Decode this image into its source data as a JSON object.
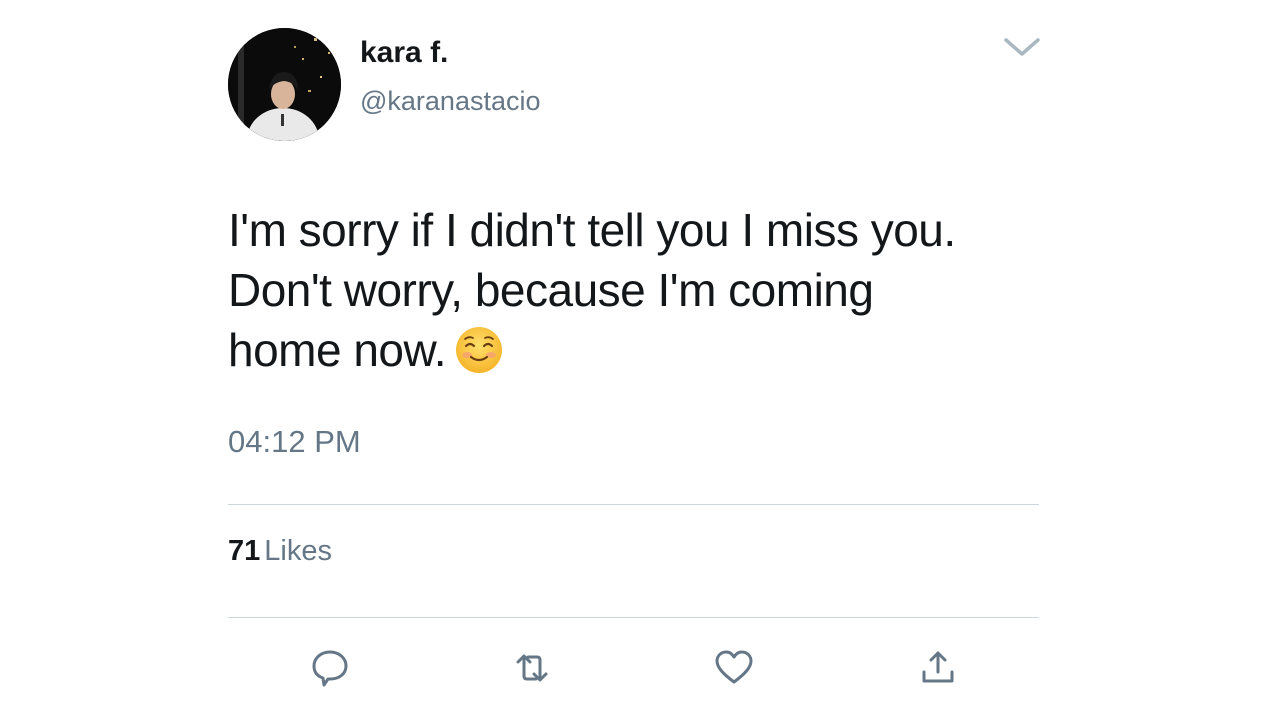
{
  "user": {
    "display_name": "kara f.",
    "handle": "@karanastacio",
    "avatar_icon": "profile-photo"
  },
  "tweet": {
    "lines": [
      "I'm sorry if I didn't tell you I miss you.",
      "Don't worry, because I'm coming",
      "home now."
    ],
    "emoji_icon": "smiling-face-with-blush-emoji",
    "timestamp": "04:12 PM"
  },
  "stats": {
    "likes_count": "71",
    "likes_label": "Likes"
  },
  "actions": {
    "reply_icon": "reply-icon",
    "retweet_icon": "retweet-icon",
    "like_icon": "heart-icon",
    "share_icon": "share-icon"
  },
  "colors": {
    "text_primary": "#14171a",
    "text_secondary": "#657786",
    "icon": "#657786",
    "divider": "#ccd6dd",
    "background": "#ffffff"
  }
}
